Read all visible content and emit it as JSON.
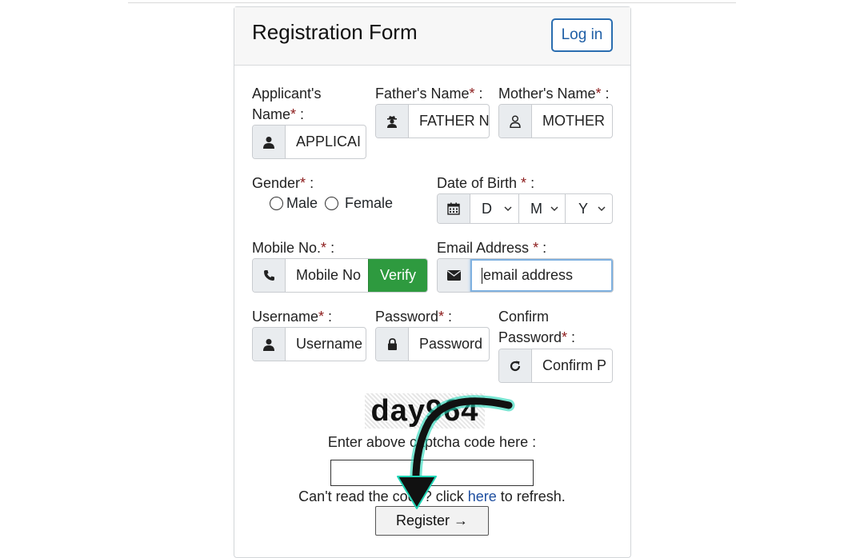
{
  "form": {
    "title": "Registration Form",
    "login_label": "Log in",
    "required_mark": "*"
  },
  "fields": {
    "applicant_name": {
      "label_line1": "Applicant's",
      "label_line2": "Name",
      "suffix": " :",
      "value": "APPLICAI"
    },
    "father_name": {
      "label": "Father's Name",
      "suffix": " :",
      "value": "FATHER N"
    },
    "mother_name": {
      "label": "Mother's Name",
      "suffix": " :",
      "value": "MOTHER"
    },
    "gender": {
      "label": "Gender",
      "suffix": " :",
      "options": [
        "Male",
        "Female"
      ]
    },
    "dob": {
      "label": "Date of Birth ",
      "suffix": " :",
      "day": "D",
      "month": "M",
      "year": "Y"
    },
    "mobile": {
      "label": "Mobile No.",
      "suffix": " :",
      "placeholder": "Mobile No",
      "verify_label": "Verify"
    },
    "email": {
      "label": "Email Address ",
      "suffix": " :",
      "placeholder": "email address"
    },
    "username": {
      "label": "Username",
      "suffix": " :",
      "placeholder": "Username"
    },
    "password": {
      "label": "Password",
      "suffix": " :",
      "placeholder": "Password"
    },
    "confirm_password": {
      "label_line1": "Confirm",
      "label_line2": "Password",
      "suffix": " :",
      "placeholder": "Confirm P"
    }
  },
  "captcha": {
    "code": "day964",
    "prompt": "Enter above captcha code here :",
    "refresh_prefix": "Can't read the code? click ",
    "refresh_link": "here",
    "refresh_suffix": " to refresh."
  },
  "register_label": "Register →",
  "icons": [
    "user-icon",
    "user-secret-icon",
    "user-outline-icon",
    "calendar-icon",
    "phone-icon",
    "envelope-icon",
    "lock-icon",
    "refresh-icon",
    "chevron-down-icon"
  ],
  "colors": {
    "verify": "#2e9a3f",
    "link": "#1f4fa0",
    "required": "#8b1a1a",
    "arrow_glow": "#1fd6b6"
  }
}
